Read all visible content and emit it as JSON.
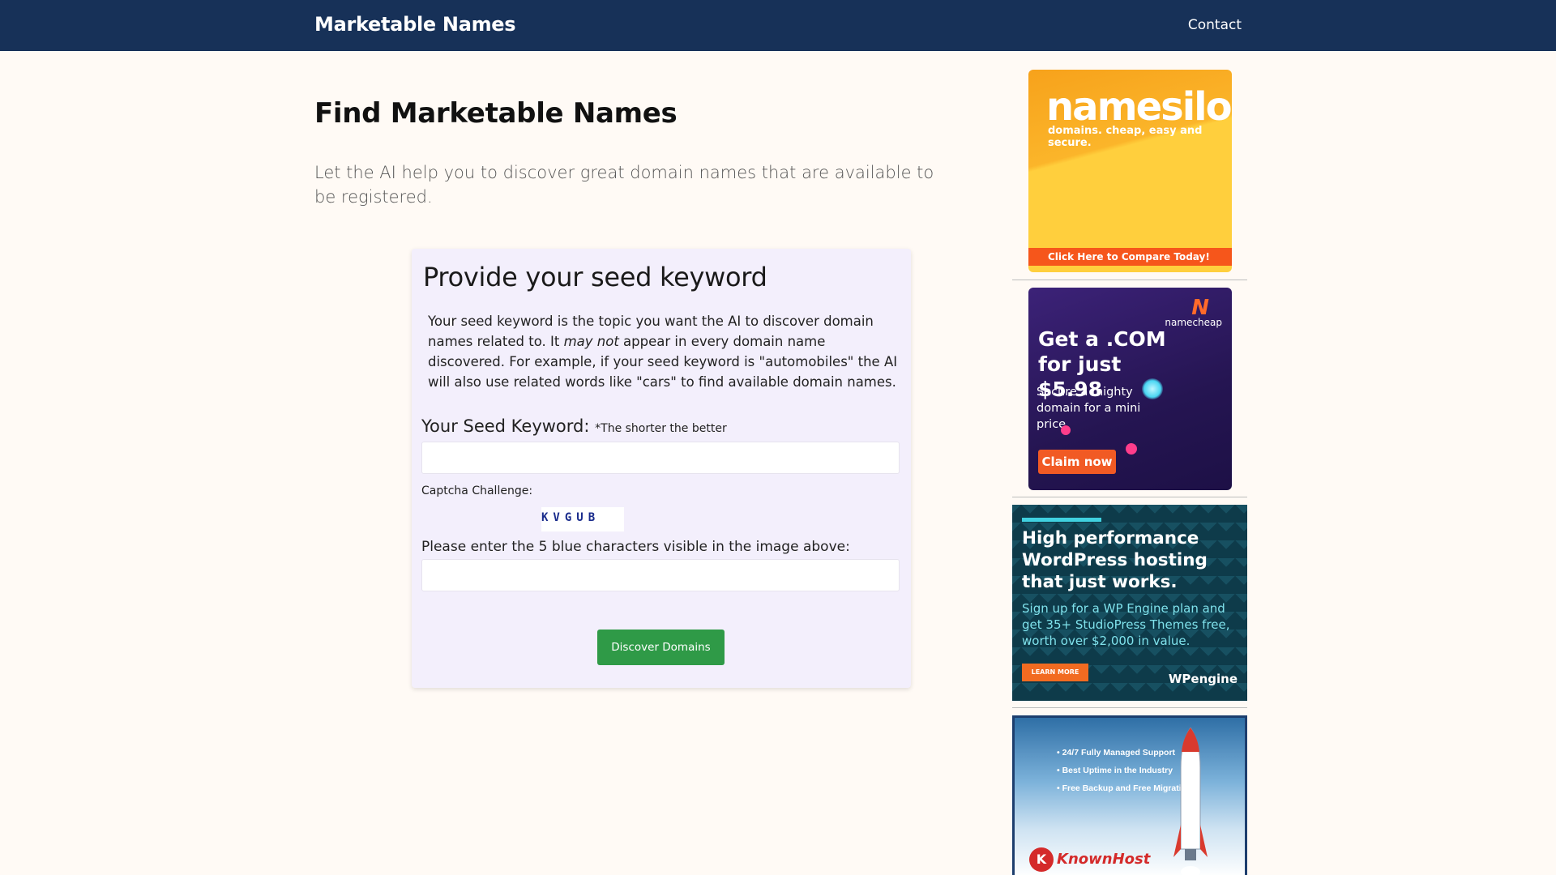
{
  "header": {
    "brand": "Marketable Names",
    "nav_contact": "Contact"
  },
  "main": {
    "title": "Find Marketable Names",
    "lead": "Let the AI help you to discover great domain names that are available to be registered."
  },
  "form": {
    "title": "Provide your seed keyword",
    "desc_part1": "Your seed keyword is the topic you want the AI to discover domain names related to. It ",
    "desc_em": "may not",
    "desc_part2": " appear in every domain name discovered. For example, if your seed keyword is \"automobiles\" the AI will also use related words like \"cars\" to find available domain names.",
    "seed_label": "Your Seed Keyword:",
    "seed_hint": "*The shorter the better",
    "seed_value": "",
    "captcha_label": "Captcha Challenge:",
    "captcha_text": "KVGUB",
    "captcha_prompt": "Please enter the 5 blue characters visible in the image above:",
    "captcha_value": "",
    "submit_label": "Discover Domains"
  },
  "ads": {
    "namesilo": {
      "logo": "namesilo",
      "tagline": "domains. cheap, easy and secure.",
      "cta": "Click Here to Compare Today!"
    },
    "namecheap": {
      "logo": "namecheap",
      "headline": "Get a .COM for just $5.98",
      "sub": "Secure a mighty domain for a mini price",
      "cta": "Claim now"
    },
    "wpengine": {
      "headline": "High performance WordPress hosting that just works.",
      "sub": "Sign up for a WP Engine plan and get 35+ StudioPress Themes free, worth over $2,000 in value.",
      "cta": "LEARN MORE",
      "logo": "WPengine"
    },
    "knownhost": {
      "bullets": [
        "• 24/7 Fully Managed Support",
        "• Best Uptime in the Industry",
        "• Free Backup and Free Migration"
      ],
      "logo": "KnownHost"
    }
  },
  "colors": {
    "header_bg": "#173158",
    "page_bg": "#fffaf5",
    "card_bg": "#f3effc",
    "button_green": "#2f9a47",
    "captcha_blue": "#1a2c8c"
  }
}
